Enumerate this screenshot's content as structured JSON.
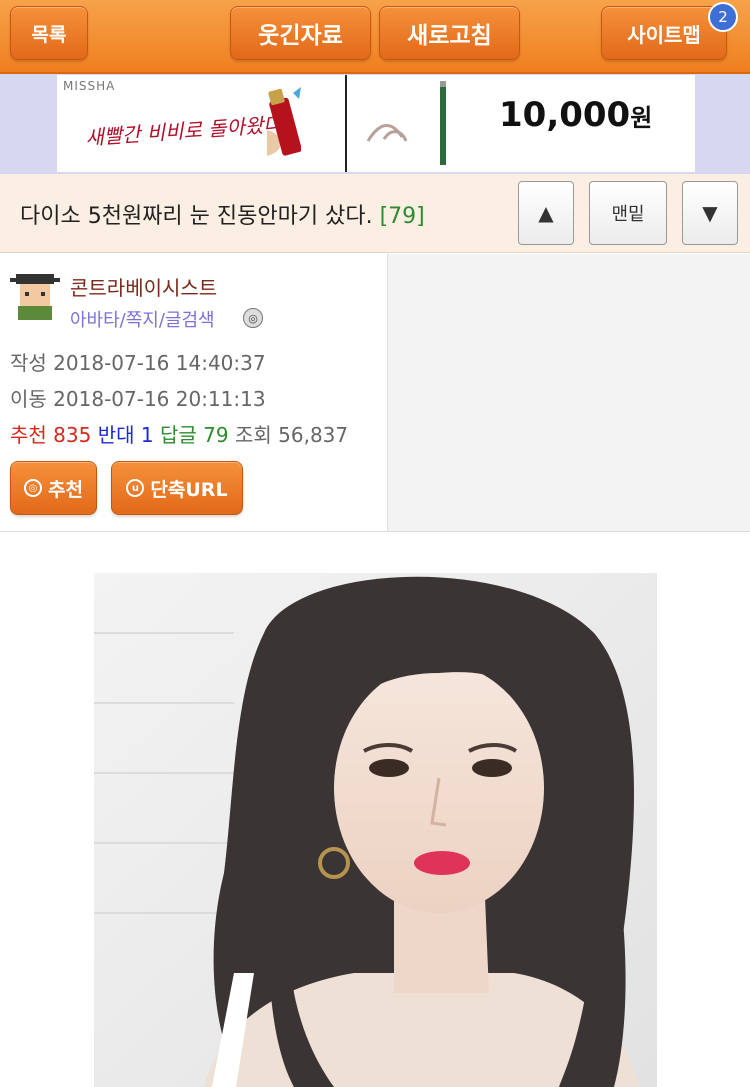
{
  "topbar": {
    "list_label": "목록",
    "humor_label": "웃긴자료",
    "refresh_label": "새로고침",
    "sitemap_label": "사이트맵",
    "sitemap_badge": "2"
  },
  "ad": {
    "brand": "MISSHA",
    "slogan": "새빨간 비비로 돌아왔다",
    "price": "10,000",
    "price_unit": "원"
  },
  "post": {
    "title": "다이소 5천원짜리 눈 진동안마기 샀다.",
    "reply_count": "[79]",
    "nav_up": "▲",
    "nav_bottom": "맨밑",
    "nav_down": "▼"
  },
  "info": {
    "author": "콘트라베이시스트",
    "links": "아바타/쪽지/글검색",
    "written_label": "작성",
    "written_at": "2018-07-16 14:40:37",
    "moved_label": "이동",
    "moved_at": "2018-07-16 20:11:13",
    "recommend_label": "추천",
    "recommend_count": "835",
    "oppose_label": "반대",
    "oppose_count": "1",
    "reply_label": "답글",
    "reply_count": "79",
    "views_label": "조회",
    "views_count": "56,837",
    "recommend_button": "추천",
    "short_url_button": "단축URL"
  },
  "colors": {
    "accent": "#ef7f1f",
    "recommend": "#d42a1c",
    "oppose": "#1c2bd4",
    "reply": "#2e8b2e"
  }
}
